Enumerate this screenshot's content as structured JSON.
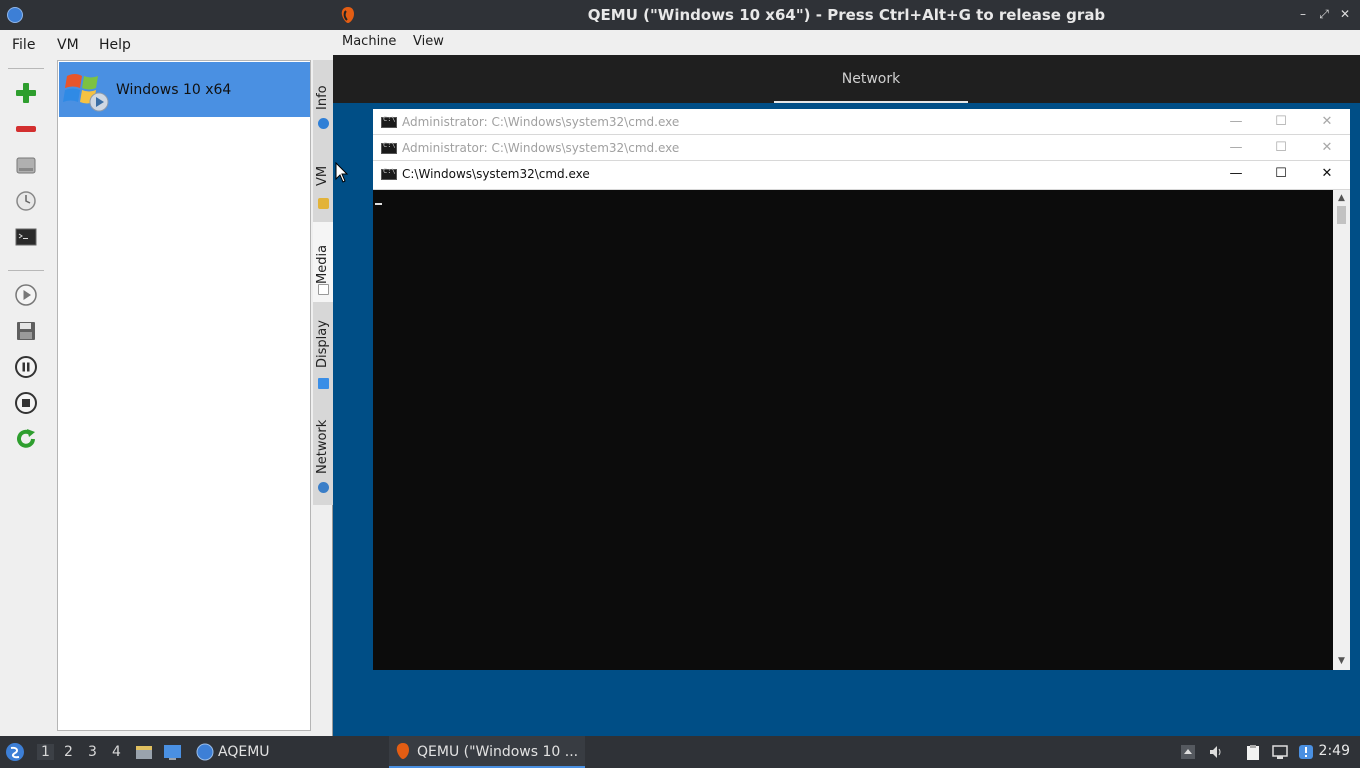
{
  "aqemu": {
    "menu": [
      "File",
      "VM",
      "Help"
    ],
    "toolbar_icons": [
      "add-vm-icon",
      "remove-vm-icon",
      "hard-disk-icon",
      "clock-icon",
      "terminal-icon",
      "play-icon",
      "save-icon",
      "pause-icon",
      "stop-icon",
      "reset-icon"
    ],
    "vm_list": [
      {
        "name": "Windows 10 x64",
        "selected": true
      }
    ],
    "side_tabs": [
      {
        "label": "Info",
        "active": false
      },
      {
        "label": "VM",
        "active": false
      },
      {
        "label": "Media",
        "active": true
      },
      {
        "label": "Display",
        "active": false
      },
      {
        "label": "Network",
        "active": false
      }
    ]
  },
  "qemu": {
    "title": "QEMU (\"Windows 10 x64\") - Press Ctrl+Alt+G to release grab",
    "controls": [
      "minimize",
      "maximize",
      "close"
    ],
    "menu": [
      "Machine",
      "View"
    ],
    "guest": {
      "top_tab": "Network",
      "cmd_windows": [
        {
          "title": "Administrator: C:\\Windows\\system32\\cmd.exe",
          "active": false
        },
        {
          "title": "Administrator: C:\\Windows\\system32\\cmd.exe",
          "active": false
        },
        {
          "title": "C:\\Windows\\system32\\cmd.exe",
          "active": true
        }
      ]
    }
  },
  "taskbar": {
    "workspaces": [
      "1",
      "2",
      "3",
      "4"
    ],
    "active_workspace": "1",
    "launcher": "AQEMU",
    "task": "QEMU (\"Windows 10 ...",
    "clock": "2:49"
  }
}
